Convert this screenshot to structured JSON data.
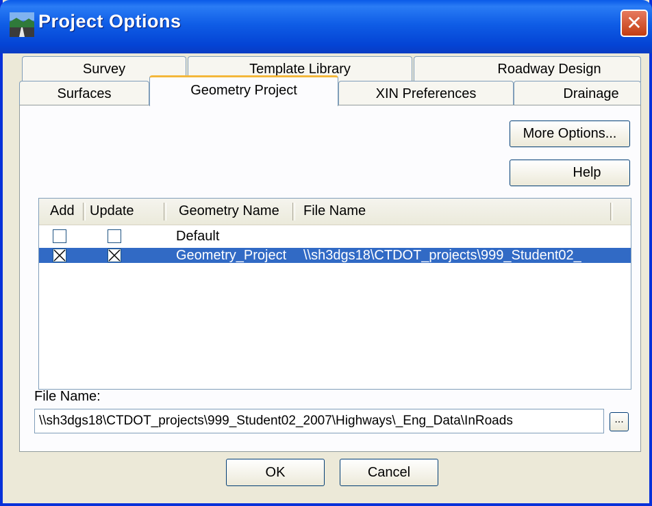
{
  "window": {
    "title": "Project Options",
    "close_label": "✕"
  },
  "tabs": {
    "row1": [
      {
        "label": "Survey"
      },
      {
        "label": "Template Library"
      },
      {
        "label": "Roadway Design"
      }
    ],
    "row2": [
      {
        "label": "Surfaces"
      },
      {
        "label": "Geometry Project",
        "active": true
      },
      {
        "label": "XIN Preferences"
      },
      {
        "label": "Drainage"
      }
    ]
  },
  "buttons": {
    "more_options": "More Options...",
    "help": "Help",
    "ok": "OK",
    "cancel": "Cancel",
    "browse": "..."
  },
  "geometry_list": {
    "columns": [
      "Add",
      "Update",
      "Geometry Name",
      "File Name"
    ],
    "rows": [
      {
        "add": false,
        "update": false,
        "name": "Default",
        "file": "",
        "selected": false
      },
      {
        "add": true,
        "update": true,
        "name": "Geometry_Project",
        "file": "\\\\sh3dgs18\\CTDOT_projects\\999_Student02_",
        "selected": true
      }
    ]
  },
  "file_name": {
    "label": "File Name:",
    "value": "\\\\sh3dgs18\\CTDOT_projects\\999_Student02_2007\\Highways\\_Eng_Data\\InRoads"
  },
  "colors": {
    "titlebar": "#0a5ae8",
    "selection": "#316ac5",
    "active_tab_accent": "#f4b73a",
    "dialog_face": "#ece9d8"
  }
}
